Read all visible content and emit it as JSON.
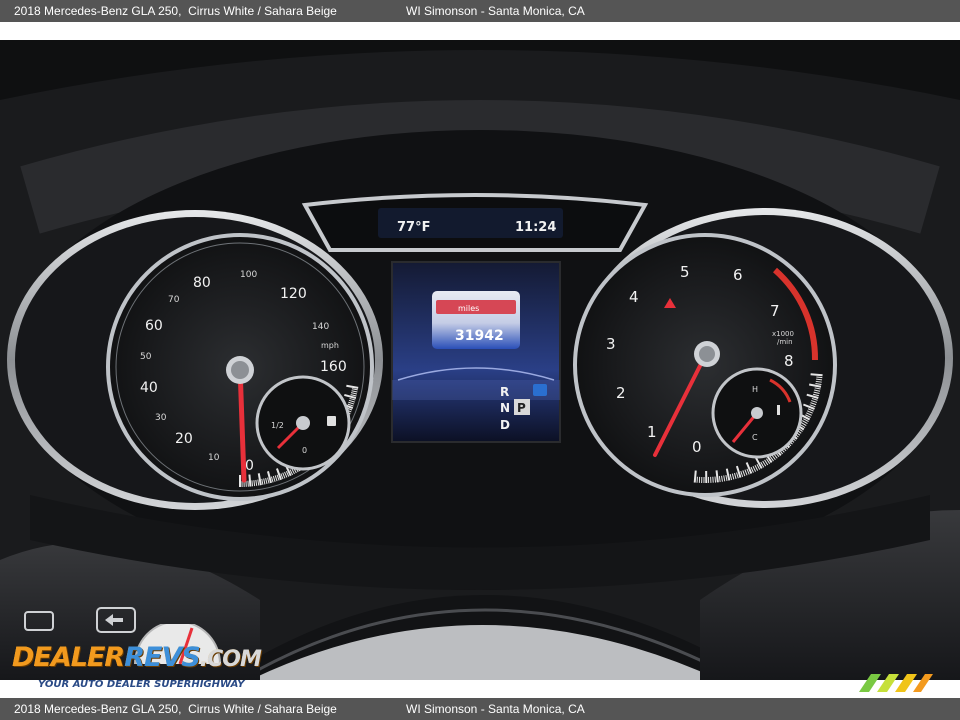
{
  "caption": {
    "car": "2018 Mercedes-Benz GLA 250,",
    "colors": "Cirrus White / Sahara Beige",
    "dealer": "WI Simonson - Santa Monica, CA"
  },
  "display": {
    "temperature": "77°F",
    "time": "11:24",
    "odometer_label": "miles",
    "odometer": "31942",
    "gears": [
      "R",
      "N",
      "P",
      "D"
    ]
  },
  "speedometer": {
    "major_labels": [
      "0",
      "20",
      "40",
      "60",
      "80",
      "120",
      "160"
    ],
    "minor_labels": [
      "10",
      "30",
      "50",
      "70",
      "100",
      "140"
    ],
    "unit": "mph"
  },
  "tachometer": {
    "labels": [
      "0",
      "1",
      "2",
      "3",
      "4",
      "5",
      "6",
      "7",
      "8"
    ],
    "unit_top": "x1000",
    "unit_bottom": "/min"
  },
  "fuel_gauge": {
    "half": "1/2",
    "empty": "0"
  },
  "temp_gauge": {
    "hot": "H",
    "cold": "C"
  },
  "watermark": {
    "brand_a": "DEALER",
    "brand_b": "REVS",
    "brand_c": ".COM",
    "tagline": "YOUR AUTO DEALER SUPERHIGHWAY"
  },
  "colors": {
    "needle": "#e8303a",
    "bezel": "#c9ccd0",
    "caption_bg": "#555555",
    "screen_blue": "#2a4fb8"
  }
}
